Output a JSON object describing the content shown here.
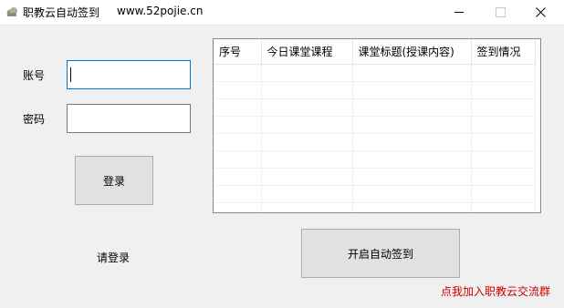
{
  "window": {
    "title": "职教云自动签到",
    "url_text": "www.52pojie.cn"
  },
  "login": {
    "account_label": "账号",
    "password_label": "密码",
    "account_value": "",
    "password_value": "",
    "login_button": "登录",
    "status_text": "请登录"
  },
  "table": {
    "columns": [
      "序号",
      "今日课堂课程",
      "课堂标题(授课内容)",
      "签到情况"
    ],
    "rows": []
  },
  "actions": {
    "auto_signin_button": "开启自动签到",
    "join_group_link": "点我加入职教云交流群"
  },
  "colors": {
    "link": "#cc0000",
    "focus_border": "#0078d7",
    "button_face": "#e1e1e1"
  }
}
